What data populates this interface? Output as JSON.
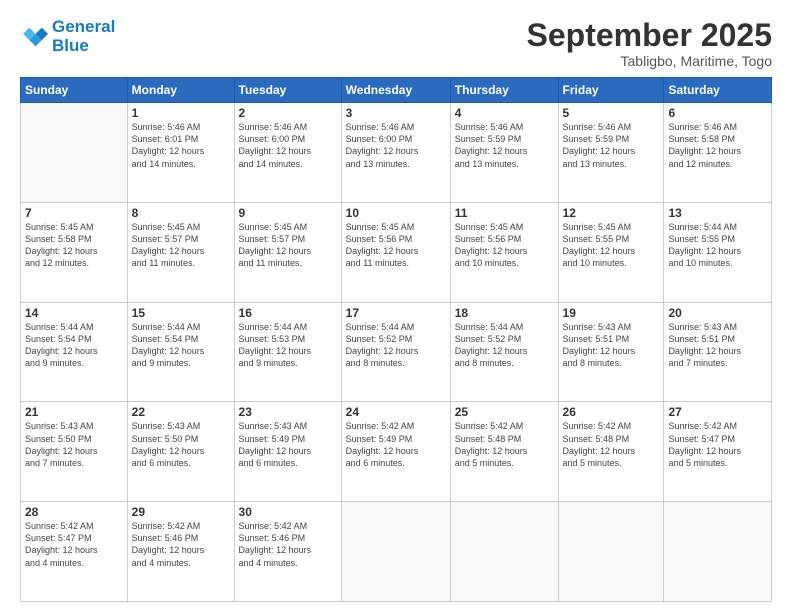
{
  "header": {
    "logo_line1": "General",
    "logo_line2": "Blue",
    "month": "September 2025",
    "location": "Tabligbo, Maritime, Togo"
  },
  "weekdays": [
    "Sunday",
    "Monday",
    "Tuesday",
    "Wednesday",
    "Thursday",
    "Friday",
    "Saturday"
  ],
  "weeks": [
    [
      {
        "day": "",
        "info": ""
      },
      {
        "day": "1",
        "info": "Sunrise: 5:46 AM\nSunset: 6:01 PM\nDaylight: 12 hours\nand 14 minutes."
      },
      {
        "day": "2",
        "info": "Sunrise: 5:46 AM\nSunset: 6:00 PM\nDaylight: 12 hours\nand 14 minutes."
      },
      {
        "day": "3",
        "info": "Sunrise: 5:46 AM\nSunset: 6:00 PM\nDaylight: 12 hours\nand 13 minutes."
      },
      {
        "day": "4",
        "info": "Sunrise: 5:46 AM\nSunset: 5:59 PM\nDaylight: 12 hours\nand 13 minutes."
      },
      {
        "day": "5",
        "info": "Sunrise: 5:46 AM\nSunset: 5:59 PM\nDaylight: 12 hours\nand 13 minutes."
      },
      {
        "day": "6",
        "info": "Sunrise: 5:46 AM\nSunset: 5:58 PM\nDaylight: 12 hours\nand 12 minutes."
      }
    ],
    [
      {
        "day": "7",
        "info": "Sunrise: 5:45 AM\nSunset: 5:58 PM\nDaylight: 12 hours\nand 12 minutes."
      },
      {
        "day": "8",
        "info": "Sunrise: 5:45 AM\nSunset: 5:57 PM\nDaylight: 12 hours\nand 11 minutes."
      },
      {
        "day": "9",
        "info": "Sunrise: 5:45 AM\nSunset: 5:57 PM\nDaylight: 12 hours\nand 11 minutes."
      },
      {
        "day": "10",
        "info": "Sunrise: 5:45 AM\nSunset: 5:56 PM\nDaylight: 12 hours\nand 11 minutes."
      },
      {
        "day": "11",
        "info": "Sunrise: 5:45 AM\nSunset: 5:56 PM\nDaylight: 12 hours\nand 10 minutes."
      },
      {
        "day": "12",
        "info": "Sunrise: 5:45 AM\nSunset: 5:55 PM\nDaylight: 12 hours\nand 10 minutes."
      },
      {
        "day": "13",
        "info": "Sunrise: 5:44 AM\nSunset: 5:55 PM\nDaylight: 12 hours\nand 10 minutes."
      }
    ],
    [
      {
        "day": "14",
        "info": "Sunrise: 5:44 AM\nSunset: 5:54 PM\nDaylight: 12 hours\nand 9 minutes."
      },
      {
        "day": "15",
        "info": "Sunrise: 5:44 AM\nSunset: 5:54 PM\nDaylight: 12 hours\nand 9 minutes."
      },
      {
        "day": "16",
        "info": "Sunrise: 5:44 AM\nSunset: 5:53 PM\nDaylight: 12 hours\nand 9 minutes."
      },
      {
        "day": "17",
        "info": "Sunrise: 5:44 AM\nSunset: 5:52 PM\nDaylight: 12 hours\nand 8 minutes."
      },
      {
        "day": "18",
        "info": "Sunrise: 5:44 AM\nSunset: 5:52 PM\nDaylight: 12 hours\nand 8 minutes."
      },
      {
        "day": "19",
        "info": "Sunrise: 5:43 AM\nSunset: 5:51 PM\nDaylight: 12 hours\nand 8 minutes."
      },
      {
        "day": "20",
        "info": "Sunrise: 5:43 AM\nSunset: 5:51 PM\nDaylight: 12 hours\nand 7 minutes."
      }
    ],
    [
      {
        "day": "21",
        "info": "Sunrise: 5:43 AM\nSunset: 5:50 PM\nDaylight: 12 hours\nand 7 minutes."
      },
      {
        "day": "22",
        "info": "Sunrise: 5:43 AM\nSunset: 5:50 PM\nDaylight: 12 hours\nand 6 minutes."
      },
      {
        "day": "23",
        "info": "Sunrise: 5:43 AM\nSunset: 5:49 PM\nDaylight: 12 hours\nand 6 minutes."
      },
      {
        "day": "24",
        "info": "Sunrise: 5:42 AM\nSunset: 5:49 PM\nDaylight: 12 hours\nand 6 minutes."
      },
      {
        "day": "25",
        "info": "Sunrise: 5:42 AM\nSunset: 5:48 PM\nDaylight: 12 hours\nand 5 minutes."
      },
      {
        "day": "26",
        "info": "Sunrise: 5:42 AM\nSunset: 5:48 PM\nDaylight: 12 hours\nand 5 minutes."
      },
      {
        "day": "27",
        "info": "Sunrise: 5:42 AM\nSunset: 5:47 PM\nDaylight: 12 hours\nand 5 minutes."
      }
    ],
    [
      {
        "day": "28",
        "info": "Sunrise: 5:42 AM\nSunset: 5:47 PM\nDaylight: 12 hours\nand 4 minutes."
      },
      {
        "day": "29",
        "info": "Sunrise: 5:42 AM\nSunset: 5:46 PM\nDaylight: 12 hours\nand 4 minutes."
      },
      {
        "day": "30",
        "info": "Sunrise: 5:42 AM\nSunset: 5:46 PM\nDaylight: 12 hours\nand 4 minutes."
      },
      {
        "day": "",
        "info": ""
      },
      {
        "day": "",
        "info": ""
      },
      {
        "day": "",
        "info": ""
      },
      {
        "day": "",
        "info": ""
      }
    ]
  ]
}
